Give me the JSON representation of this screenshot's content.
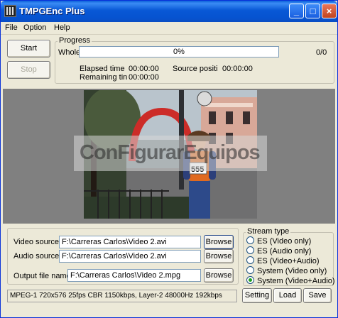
{
  "window": {
    "title": "TMPGEnc Plus",
    "minimize": "_",
    "maximize": "□",
    "close": "×"
  },
  "menu": {
    "file": "File",
    "option": "Option",
    "help": "Help"
  },
  "actions": {
    "start": "Start",
    "stop": "Stop"
  },
  "progress": {
    "group_label": "Progress",
    "whole_label": "Whole",
    "percent_text": "0%",
    "value": 0,
    "count": "0/0",
    "elapsed_label": "Elapsed time",
    "elapsed_value": "00:00:00",
    "remaining_label": "Remaining tin",
    "remaining_value": "00:00:00",
    "source_label": "Source positi",
    "source_value": "00:00:00"
  },
  "preview": {
    "watermark": "ConFigurarEquipos"
  },
  "sources": {
    "video_label": "Video source:",
    "video_value": "F:\\Carreras Carlos\\Video 2.avi",
    "audio_label": "Audio source:",
    "audio_value": "F:\\Carreras Carlos\\Video 2.avi",
    "output_label": "Output file name:",
    "output_value": "F:\\Carreras Carlos\\Video 2.mpg",
    "browse": "Browse"
  },
  "stream_type": {
    "label": "Stream type",
    "options": [
      "ES (Video only)",
      "ES (Audio only)",
      "ES (Video+Audio)",
      "System (Video only)",
      "System (Video+Audio)"
    ],
    "selected": "System (Video+Audio)"
  },
  "status": {
    "text": "MPEG-1 720x576 25fps CBR 1150kbps,  Layer-2 48000Hz 192kbps"
  },
  "bottom_buttons": {
    "setting": "Setting",
    "load": "Load",
    "save": "Save"
  }
}
